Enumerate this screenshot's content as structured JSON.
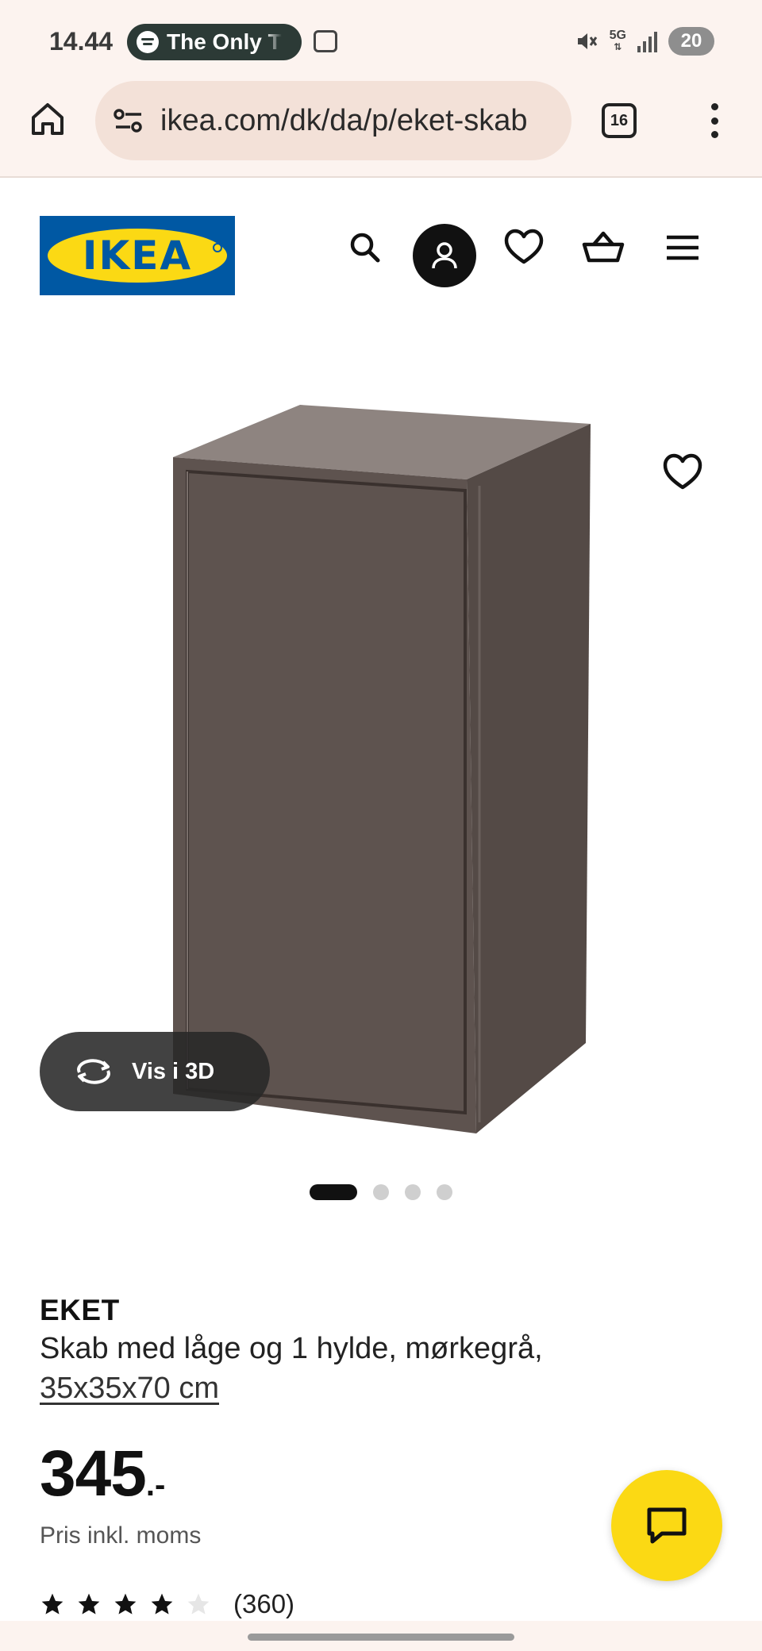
{
  "status_bar": {
    "time": "14.44",
    "media_pill_text": "The Only T",
    "network_label": "5G",
    "battery_level": "20"
  },
  "browser": {
    "url": "ikea.com/dk/da/p/eket-skab",
    "tab_count": "16"
  },
  "site_header": {
    "logo_text": "IKEA",
    "icons": [
      "search-icon",
      "user-icon",
      "heart-icon",
      "basket-icon",
      "hamburger-menu-icon"
    ]
  },
  "gallery": {
    "view_3d_label": "Vis i 3D",
    "image_count": 4,
    "active_image_index": 0
  },
  "product": {
    "name": "EKET",
    "description": "Skab med låge og 1 hylde, mørkegrå,",
    "size_link": "35x35x70 cm",
    "price_integer": "345",
    "price_suffix": ".-",
    "price_note": "Pris inkl. moms",
    "rating_value": 4,
    "rating_max": 5,
    "review_count": "(360)"
  },
  "colors": {
    "ikea_blue": "#0058a3",
    "ikea_yellow": "#fbd914",
    "cabinet_front": "#5e534f",
    "cabinet_side": "#544a46",
    "cabinet_top": "#8e8480"
  }
}
